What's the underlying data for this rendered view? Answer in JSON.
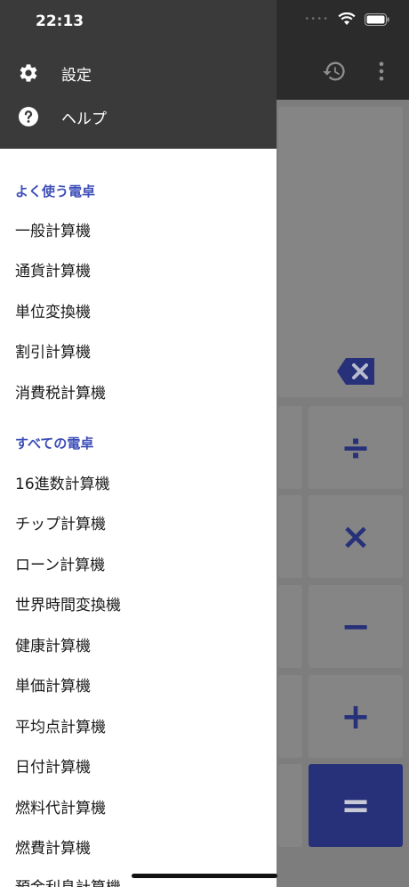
{
  "status_bar": {
    "time": "22:13"
  },
  "drawer": {
    "header_items": [
      {
        "label": "設定",
        "icon": "gear-icon"
      },
      {
        "label": "ヘルプ",
        "icon": "help-icon"
      }
    ],
    "favorites_title": "よく使う電卓",
    "favorites": [
      "一般計算機",
      "通貨計算機",
      "単位変換機",
      "割引計算機",
      "消費税計算機"
    ],
    "all_title": "すべての電卓",
    "all": [
      "16進数計算機",
      "チップ計算機",
      "ローン計算機",
      "世界時間変換機",
      "健康計算機",
      "単価計算機",
      "平均点計算機",
      "日付計算機",
      "燃料代計算機",
      "燃費計算機",
      "預金利息計算機"
    ]
  },
  "calculator": {
    "operators": [
      "÷",
      "×",
      "−",
      "+",
      "="
    ]
  },
  "colors": {
    "accent": "#3d4eb8",
    "header_bg": "#3a3a3a",
    "operator": "#27317a"
  }
}
